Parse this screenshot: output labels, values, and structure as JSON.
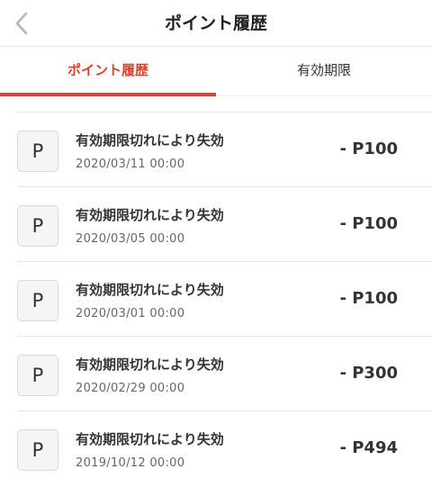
{
  "colors": {
    "accent": "#e0412f",
    "text": "#333333",
    "muted": "#666666",
    "divider": "#e4e4e4"
  },
  "header": {
    "back_icon": "chevron-left-icon",
    "title": "ポイント履歴"
  },
  "tabs": [
    {
      "label": "ポイント履歴",
      "active": true
    },
    {
      "label": "有効期限",
      "active": false
    }
  ],
  "history": [
    {
      "badge": "P",
      "title": "有効期限切れにより失効",
      "date": "2020/03/11 00:00",
      "amount": "- P100"
    },
    {
      "badge": "P",
      "title": "有効期限切れにより失効",
      "date": "2020/03/05 00:00",
      "amount": "- P100"
    },
    {
      "badge": "P",
      "title": "有効期限切れにより失効",
      "date": "2020/03/01 00:00",
      "amount": "- P100"
    },
    {
      "badge": "P",
      "title": "有効期限切れにより失効",
      "date": "2020/02/29 00:00",
      "amount": "- P300"
    },
    {
      "badge": "P",
      "title": "有効期限切れにより失効",
      "date": "2019/10/12 00:00",
      "amount": "- P494"
    }
  ]
}
